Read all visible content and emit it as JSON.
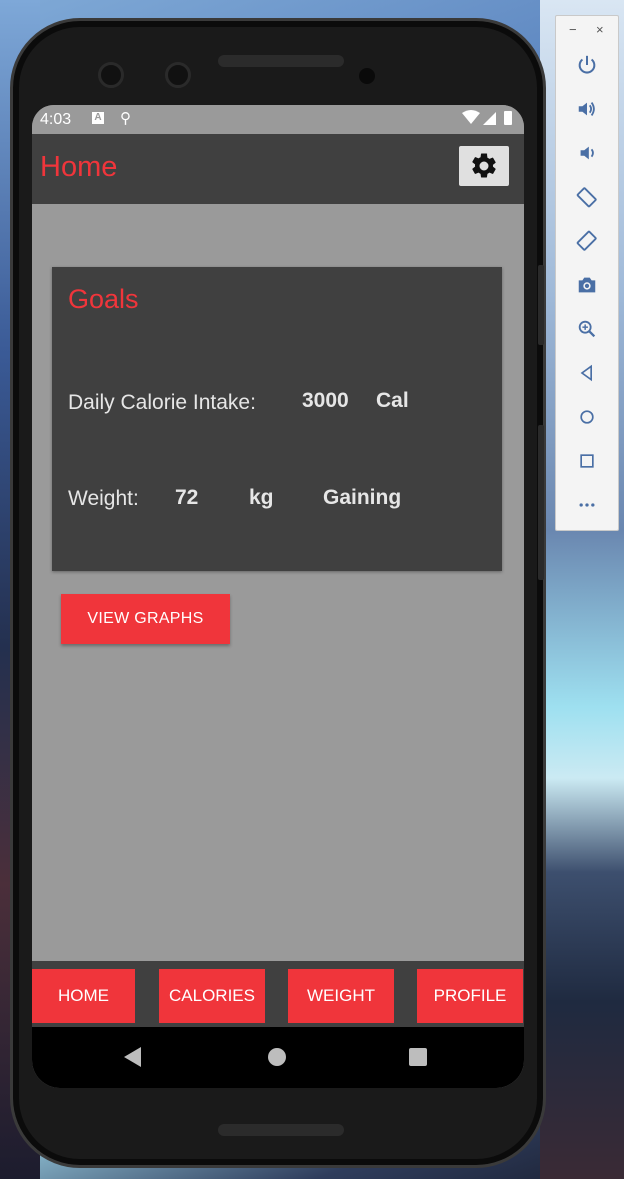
{
  "status_bar": {
    "time": "4:03",
    "notification_icon_a": "A",
    "notification_icon_b": "⚲",
    "system_icons": "▾◢▮"
  },
  "app_bar": {
    "title": "Home",
    "settings_icon": "gear-icon"
  },
  "goals_card": {
    "title": "Goals",
    "calorie_label": "Daily Calorie Intake:",
    "calorie_value": "3000",
    "calorie_unit": "Cal",
    "weight_label": "Weight:",
    "weight_value": "72",
    "weight_unit": "kg",
    "weight_goal": "Gaining"
  },
  "view_graphs_label": "VIEW GRAPHS",
  "bottom_tabs": [
    {
      "label": "HOME"
    },
    {
      "label": "CALORIES"
    },
    {
      "label": "WEIGHT"
    },
    {
      "label": "PROFILE"
    }
  ],
  "nav_bar": {
    "back_icon": "triangle-back-icon",
    "home_icon": "circle-home-icon",
    "recent_icon": "square-recent-icon"
  },
  "emulator_toolbar": {
    "minimize": "−",
    "close": "×",
    "items": [
      "power-icon",
      "volume-up-icon",
      "volume-down-icon",
      "rotate-left-icon",
      "rotate-right-icon",
      "camera-icon",
      "zoom-icon",
      "back-icon",
      "home-icon",
      "overview-icon",
      "more-icon"
    ]
  },
  "colors": {
    "accent": "#f0353b",
    "bar": "#404040",
    "background": "#9a9a9a"
  }
}
